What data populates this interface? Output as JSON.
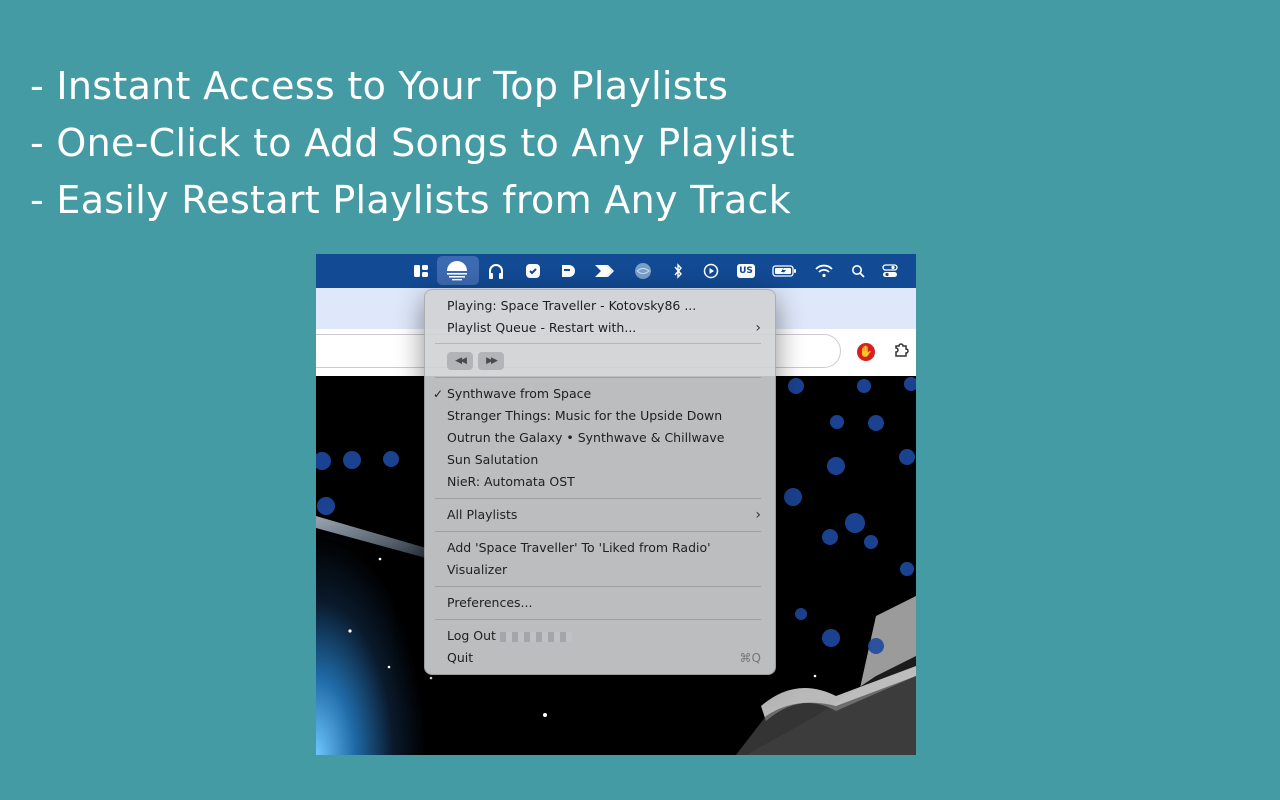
{
  "features": [
    "- Instant Access to Your Top Playlists",
    "- One-Click to Add Songs to Any Playlist",
    "- Easily Restart Playlists from Any Track"
  ],
  "menubar_icons": [
    "layout-icon",
    "app-sunset-icon",
    "headphones-icon",
    "shield-icon",
    "bookmark-icon",
    "arrows-icon",
    "globe-icon",
    "bluetooth-icon",
    "play-circle-icon",
    "keyboard-us-icon",
    "battery-icon",
    "wifi-icon",
    "search-icon",
    "control-center-icon"
  ],
  "menubar": {
    "keyboard_label": "US"
  },
  "menu": {
    "now_playing": "Playing: Space Traveller - Kotovsky86 ...",
    "queue": "Playlist Queue - Restart with...",
    "checkmark": "✓",
    "chevron": "›",
    "prev_button": "◀◀",
    "next_button": "▶▶",
    "playlists": [
      "Synthwave from Space",
      "Stranger Things: Music for the Upside Down",
      "Outrun the Galaxy • Synthwave & Chillwave",
      "Sun Salutation",
      "NieR: Automata OST"
    ],
    "all_playlists": "All Playlists",
    "add_to_liked": "Add 'Space Traveller' To 'Liked from Radio'",
    "visualizer": "Visualizer",
    "preferences": "Preferences...",
    "log_out": "Log Out",
    "quit": "Quit",
    "quit_shortcut": "⌘Q"
  },
  "colors": {
    "background": "#449ba4",
    "menubar": "#124a94",
    "browser_tab_strip": "#dfe8fb",
    "menu_background": "#d0d2d4"
  }
}
